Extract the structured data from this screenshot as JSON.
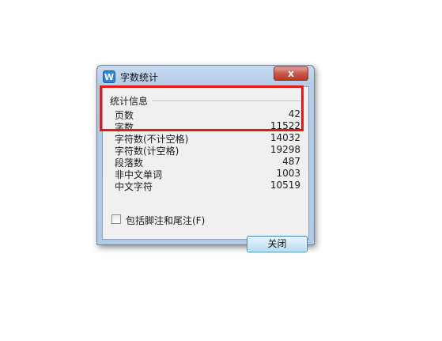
{
  "window": {
    "title": "字数统计",
    "icon": "wps-writer-icon",
    "close_glyph": "x"
  },
  "stats": {
    "group_label": "统计信息",
    "rows": [
      {
        "label": "页数",
        "value": "42"
      },
      {
        "label": "字数",
        "value": "11522"
      },
      {
        "label": "字符数(不计空格)",
        "value": "14032"
      },
      {
        "label": "字符数(计空格)",
        "value": "19298"
      },
      {
        "label": "段落数",
        "value": "487"
      },
      {
        "label": "非中文单词",
        "value": "1003"
      },
      {
        "label": "中文字符",
        "value": "10519"
      }
    ]
  },
  "options": {
    "include_footnotes_label": "包括脚注和尾注(F)",
    "include_footnotes_checked": false
  },
  "buttons": {
    "close_label": "关闭"
  },
  "colors": {
    "highlight": "#e01919",
    "title_bar": "#b6cde8",
    "close_button": "#c8594a"
  }
}
